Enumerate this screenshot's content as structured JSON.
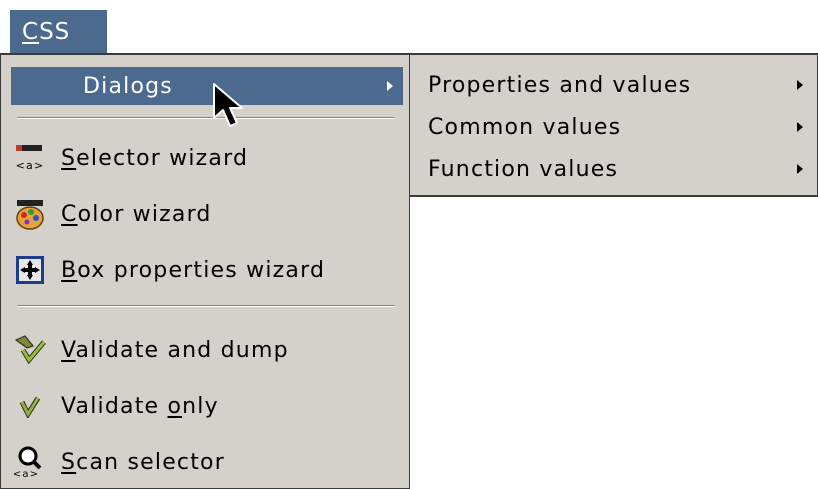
{
  "menubar": {
    "css_label_first": "C",
    "css_label_rest": "SS"
  },
  "menu": {
    "items": [
      {
        "label": "Dialogs",
        "icon": "none",
        "selected": true,
        "has_submenu": true
      },
      {
        "mnemonic": "S",
        "label_rest": "elector wizard",
        "icon": "selector-wizard-icon"
      },
      {
        "mnemonic": "C",
        "label_rest": "olor wizard",
        "icon": "color-palette-icon"
      },
      {
        "mnemonic": "B",
        "label_rest": "ox properties wizard",
        "icon": "box-properties-icon"
      },
      {
        "mnemonic": "V",
        "label_rest": "alidate and dump",
        "icon": "validate-dump-icon"
      },
      {
        "label_pre": "Validate ",
        "mnemonic": "o",
        "label_rest": "nly",
        "icon": "checkmark-icon"
      },
      {
        "mnemonic": "S",
        "label_rest": "can selector",
        "icon": "scan-selector-icon"
      }
    ]
  },
  "submenu": {
    "items": [
      {
        "label": "Properties and values"
      },
      {
        "label": "Common values"
      },
      {
        "label": "Function values"
      }
    ]
  },
  "colors": {
    "highlight": "#4c6a8e",
    "menu_bg": "#d4d1cb"
  }
}
